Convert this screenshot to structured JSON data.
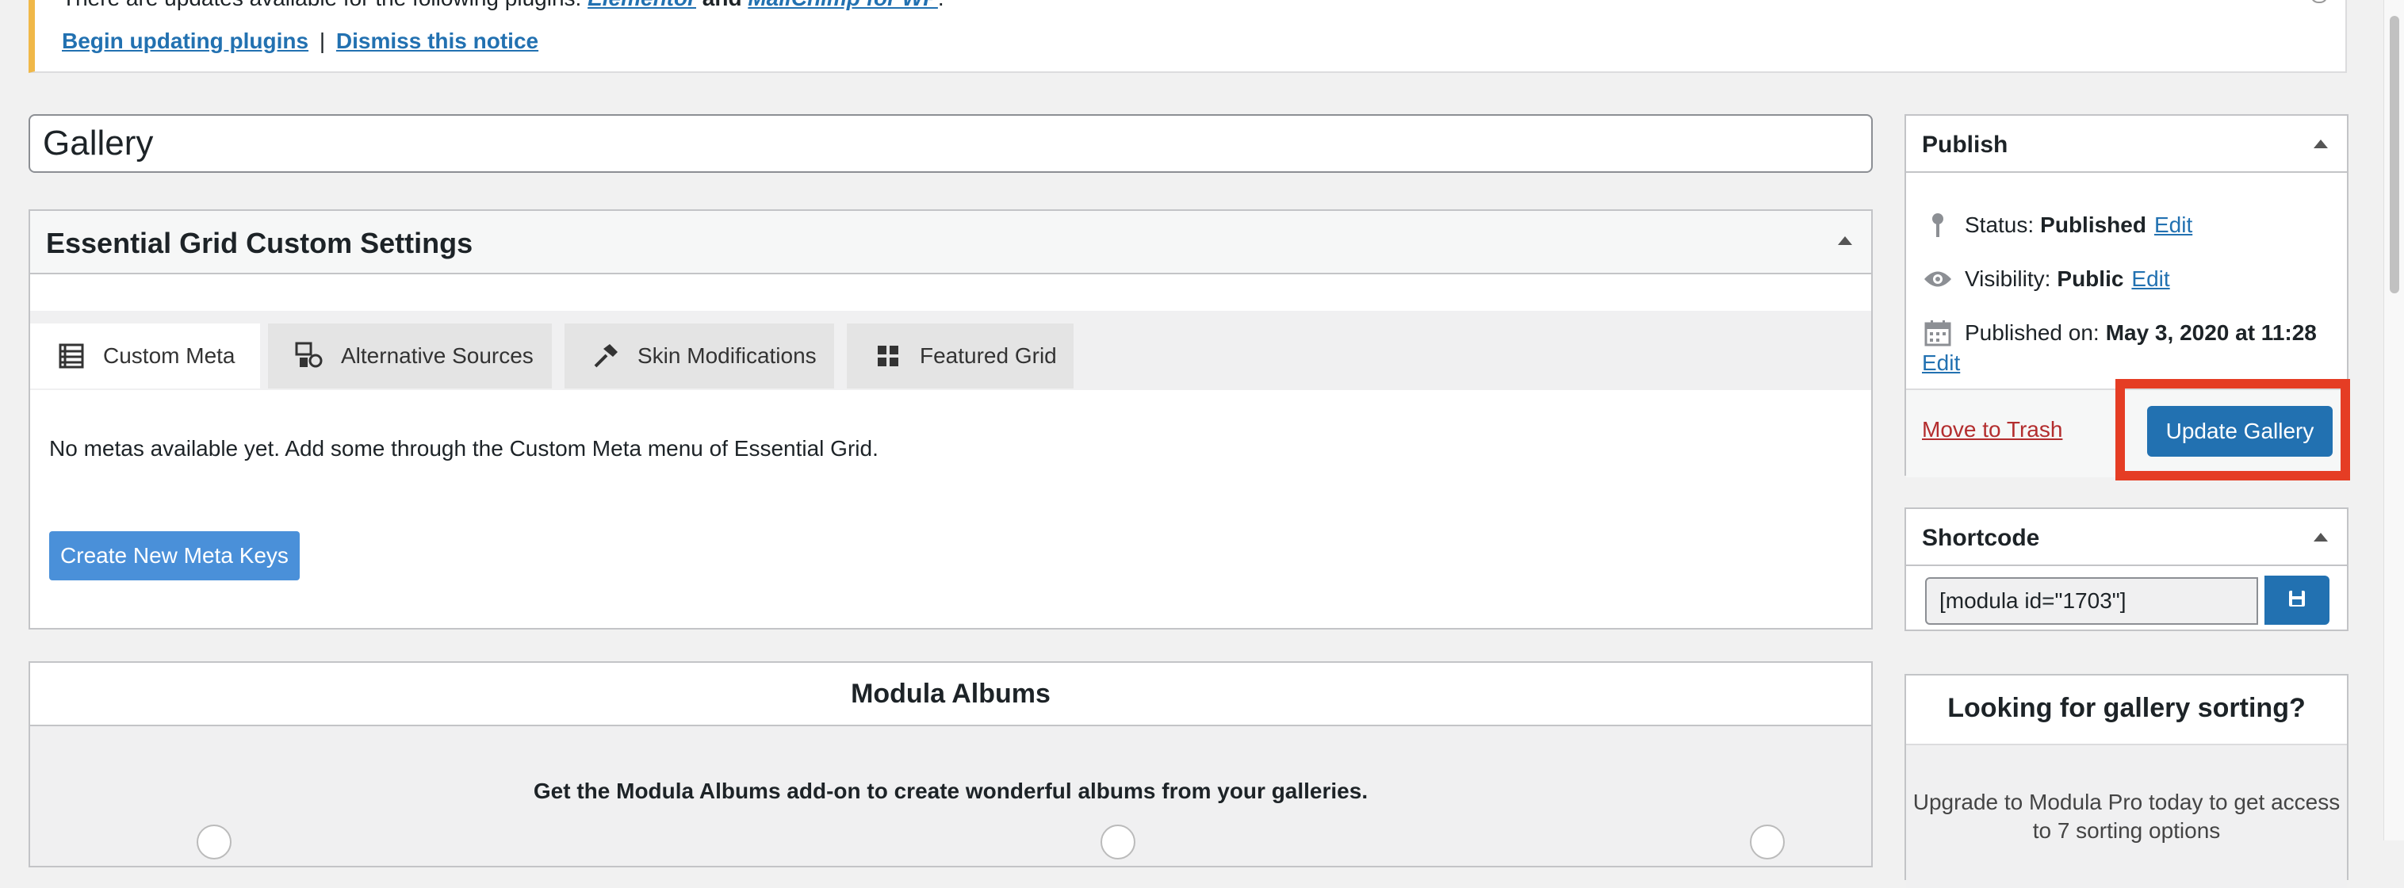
{
  "notice": {
    "text_prefix": "There are updates available for the following plugins:",
    "plugin1": "Elementor",
    "and": "and",
    "plugin2": "MailChimp for WP",
    "period": ".",
    "begin_link": "Begin updating plugins",
    "separator": "|",
    "dismiss_link": "Dismiss this notice"
  },
  "title": {
    "value": "Gallery"
  },
  "essential_grid": {
    "heading": "Essential Grid Custom Settings",
    "tabs": [
      {
        "label": "Custom Meta",
        "icon": "list-icon",
        "active": true
      },
      {
        "label": "Alternative Sources",
        "icon": "media-icon",
        "active": false
      },
      {
        "label": "Skin Modifications",
        "icon": "hammer-icon",
        "active": false
      },
      {
        "label": "Featured Grid",
        "icon": "grid-icon",
        "active": false
      }
    ],
    "message": "No metas available yet. Add some through the Custom Meta menu of Essential Grid.",
    "create_button": "Create New Meta Keys"
  },
  "modula_albums": {
    "heading": "Modula Albums",
    "subheading": "Get the Modula Albums add-on to create wonderful albums from your galleries."
  },
  "publish": {
    "heading": "Publish",
    "status_label": "Status:",
    "status_value": "Published",
    "visibility_label": "Visibility:",
    "visibility_value": "Public",
    "published_label": "Published on:",
    "published_value": "May 3, 2020 at 11:28",
    "edit": "Edit",
    "trash": "Move to Trash",
    "update_button": "Update Gallery"
  },
  "shortcode": {
    "heading": "Shortcode",
    "value": "[modula id=\"1703\"]"
  },
  "sorting": {
    "heading": "Looking for gallery sorting?",
    "text": "Upgrade to Modula Pro today to get access to 7 sorting options"
  },
  "colors": {
    "primary": "#2271b1",
    "notice_border": "#f0b849",
    "highlight": "#e53d24",
    "trash": "#b32d2e"
  }
}
